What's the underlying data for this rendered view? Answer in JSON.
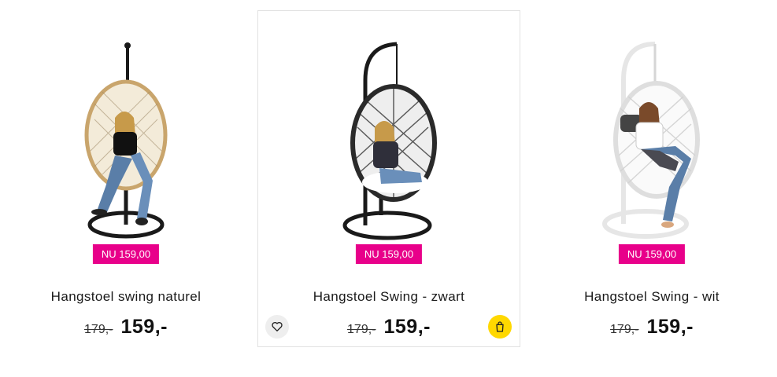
{
  "products": [
    {
      "badge": "NU 159,00",
      "title": "Hangstoel swing naturel",
      "old_price": "179,-",
      "new_price": "159,-",
      "image_alt": "egg-chair-natural"
    },
    {
      "badge": "NU 159,00",
      "title": "Hangstoel Swing - zwart",
      "old_price": "179,-",
      "new_price": "159,-",
      "image_alt": "egg-chair-black"
    },
    {
      "badge": "NU 159,00",
      "title": "Hangstoel Swing - wit",
      "old_price": "179,-",
      "new_price": "159,-",
      "image_alt": "egg-chair-white"
    }
  ],
  "colors": {
    "badge_bg": "#e8008a",
    "cart_button_bg": "#ffd800",
    "wishlist_button_bg": "#eeeeee"
  },
  "icons": {
    "wishlist": "heart-icon",
    "cart": "shopping-bag-icon"
  }
}
